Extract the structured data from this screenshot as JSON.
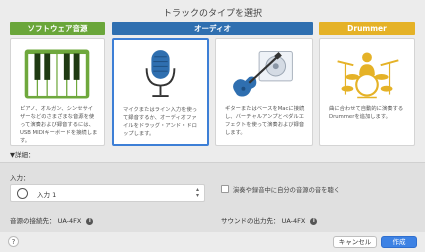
{
  "dialog": {
    "title": "トラックのタイプを選択"
  },
  "categories": {
    "software": "ソフトウェア音源",
    "audio": "オーディオ",
    "drummer": "Drummer"
  },
  "tiles": {
    "software": {
      "icon": "piano-keyboard-icon",
      "desc": "ピアノ、オルガン、シンセサイザーなどのさまざまな音源を使って演奏および録音するには、USB MIDIキーボードを接続します。"
    },
    "microphone": {
      "icon": "microphone-icon",
      "desc": "マイクまたはライン入力を使って録音するか、オーディオファイルをドラッグ・アンド・ドロップします。",
      "selected": true
    },
    "guitar": {
      "icon": "guitar-icon",
      "desc": "ギターまたはベースをMacに接続し、バーチャルアンプとペダルエフェクトを使って演奏および録音します。"
    },
    "drummer": {
      "icon": "drum-kit-icon",
      "desc": "曲に合わせて自動的に演奏するDrummerを追加します。"
    }
  },
  "details": {
    "label": "▼詳細："
  },
  "input": {
    "label": "入力：",
    "value": "入力 1",
    "monitor_label": "演奏や録音中に自分の音源の音を聴く",
    "monitor_checked": false
  },
  "footer": {
    "input_device_label": "音源の接続先：",
    "input_device": "UA-4FX",
    "output_device_label": "サウンドの出力先：",
    "output_device": "UA-4FX",
    "info_glyph": "i",
    "help_glyph": "?"
  },
  "buttons": {
    "cancel": "キャンセル",
    "create": "作成"
  },
  "colors": {
    "software": "#6aa63a",
    "audio": "#2f6fb0",
    "drummer": "#e5b227",
    "accent": "#3d82e4"
  }
}
